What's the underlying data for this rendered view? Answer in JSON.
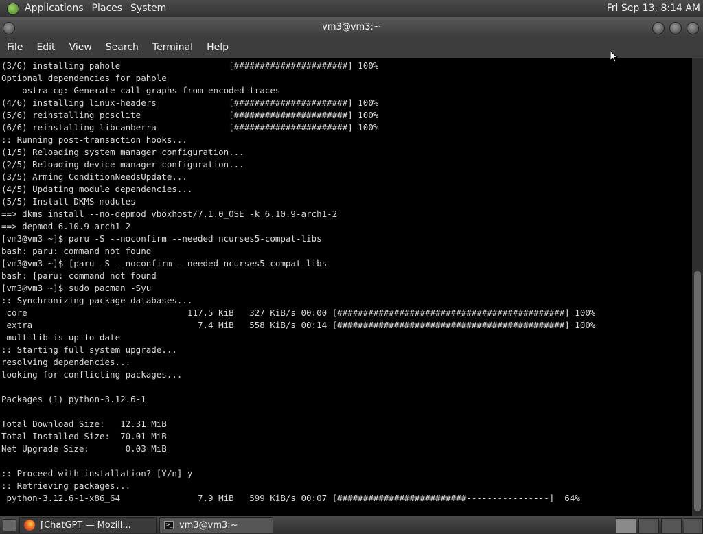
{
  "top_panel": {
    "menus": [
      "Applications",
      "Places",
      "System"
    ],
    "clock": "Fri Sep 13,  8:14 AM"
  },
  "window": {
    "title": "vm3@vm3:~"
  },
  "menu_bar": [
    "File",
    "Edit",
    "View",
    "Search",
    "Terminal",
    "Help"
  ],
  "terminal": {
    "lines": [
      "(3/6) installing pahole                     [######################] 100%",
      "Optional dependencies for pahole",
      "    ostra-cg: Generate call graphs from encoded traces",
      "(4/6) installing linux-headers              [######################] 100%",
      "(5/6) reinstalling pcsclite                 [######################] 100%",
      "(6/6) reinstalling libcanberra              [######################] 100%",
      ":: Running post-transaction hooks...",
      "(1/5) Reloading system manager configuration...",
      "(2/5) Reloading device manager configuration...",
      "(3/5) Arming ConditionNeedsUpdate...",
      "(4/5) Updating module dependencies...",
      "(5/5) Install DKMS modules",
      "==> dkms install --no-depmod vboxhost/7.1.0_OSE -k 6.10.9-arch1-2",
      "==> depmod 6.10.9-arch1-2",
      "[vm3@vm3 ~]$ paru -S --noconfirm --needed ncurses5-compat-libs",
      "bash: paru: command not found",
      "[vm3@vm3 ~]$ [paru -S --noconfirm --needed ncurses5-compat-libs",
      "bash: [paru: command not found",
      "[vm3@vm3 ~]$ sudo pacman -Syu",
      ":: Synchronizing package databases...",
      " core                               117.5 KiB   327 KiB/s 00:00 [############################################] 100%",
      " extra                                7.4 MiB   558 KiB/s 00:14 [############################################] 100%",
      " multilib is up to date",
      ":: Starting full system upgrade...",
      "resolving dependencies...",
      "looking for conflicting packages...",
      "",
      "Packages (1) python-3.12.6-1",
      "",
      "Total Download Size:   12.31 MiB",
      "Total Installed Size:  70.01 MiB",
      "Net Upgrade Size:       0.03 MiB",
      "",
      ":: Proceed with installation? [Y/n] y",
      ":: Retrieving packages...",
      " python-3.12.6-1-x86_64               7.9 MiB   599 KiB/s 00:07 [#########################----------------]  64%"
    ]
  },
  "taskbar": {
    "tasks": [
      {
        "label": "[ChatGPT — Mozill...",
        "icon": "firefox-icon"
      },
      {
        "label": "vm3@vm3:~",
        "icon": "terminal-icon"
      }
    ]
  }
}
